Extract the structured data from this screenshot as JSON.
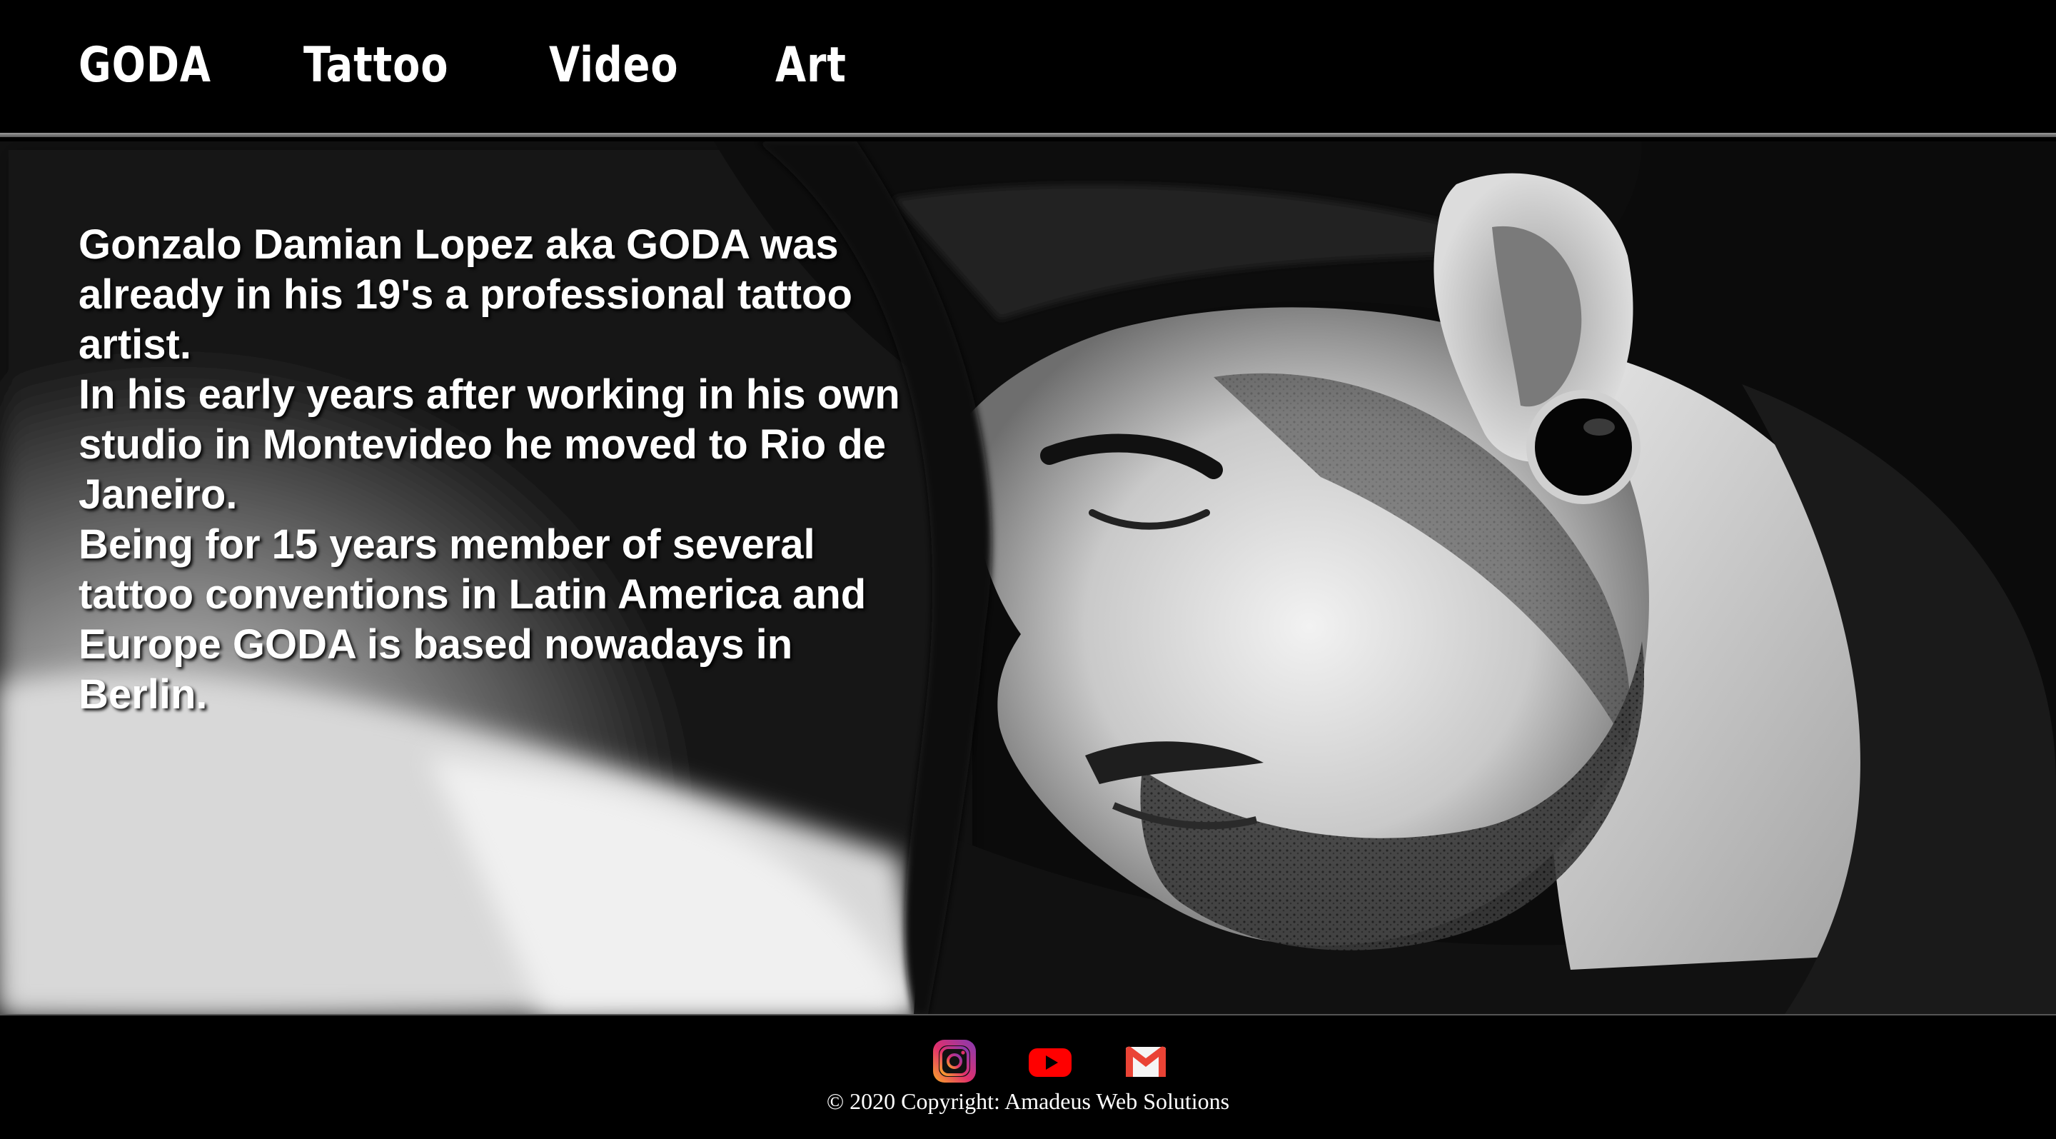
{
  "nav": {
    "brand": "GODA",
    "items": [
      {
        "label": "Tattoo"
      },
      {
        "label": "Video"
      },
      {
        "label": "Art"
      }
    ]
  },
  "hero": {
    "paragraphs": [
      "Gonzalo Damian Lopez aka GODA was already in his 19's a professional tattoo artist.",
      "In his early years after working in his own studio in Montevideo he moved to Rio de Janeiro.",
      "Being for 15 years member of several tattoo conventions in Latin America and Europe GODA is based nowadays in Berlin."
    ]
  },
  "footer": {
    "social": [
      {
        "icon": "instagram-icon",
        "color": "#c13584"
      },
      {
        "icon": "youtube-icon",
        "color": "#ff0000"
      },
      {
        "icon": "gmail-icon",
        "color": "#ea4335"
      }
    ],
    "copyright": "© 2020 Copyright: Amadeus Web Solutions"
  }
}
